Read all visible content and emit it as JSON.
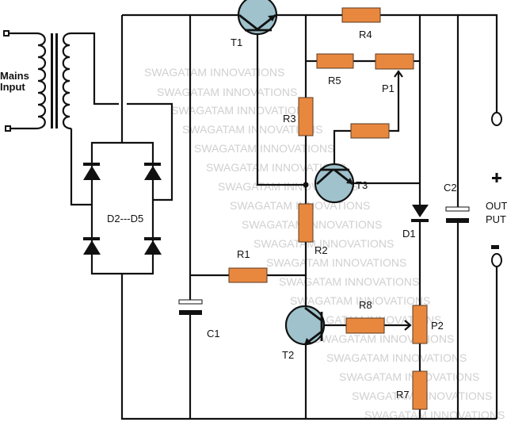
{
  "diagram": {
    "type": "circuit-schematic",
    "labels": {
      "mains_input_line1": "Mains",
      "mains_input_line2": "Input",
      "t1": "T1",
      "t2": "T2",
      "t3": "T3",
      "r1": "R1",
      "r2": "R2",
      "r3": "R3",
      "r4": "R4",
      "r5": "R5",
      "r7": "R7",
      "r8": "R8",
      "p1": "P1",
      "p2": "P2",
      "c1": "C1",
      "c2": "C2",
      "d1": "D1",
      "bridge": "D2---D5",
      "output_line1": "OUT",
      "output_line2": "PUT",
      "plus": "+",
      "minus": "-"
    },
    "watermark": "SWAGATAM INNOVATIONS",
    "colors": {
      "resistor": "#e8883f",
      "transistor": "#9fc2cc",
      "wire": "#111111",
      "watermark": "#d0d0d0"
    }
  }
}
